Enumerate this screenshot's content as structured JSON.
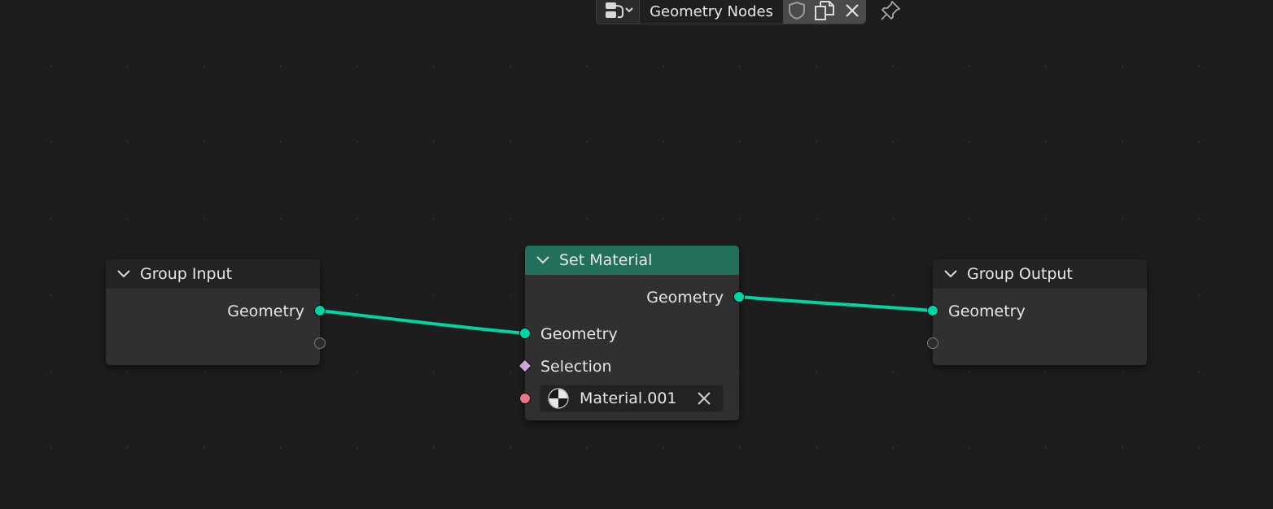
{
  "header": {
    "node_tree_name": "Geometry Nodes",
    "browse_icon": "node-tree-browse-icon",
    "fake_user_icon": "shield-icon",
    "duplicate_icon": "duplicate-icon",
    "unlink_icon": "close-icon",
    "pin_icon": "pin-icon"
  },
  "nodes": {
    "group_input": {
      "title": "Group Input",
      "outputs": [
        {
          "label": "Geometry",
          "type": "geometry"
        }
      ]
    },
    "set_material": {
      "title": "Set Material",
      "outputs": [
        {
          "label": "Geometry",
          "type": "geometry"
        }
      ],
      "inputs": [
        {
          "label": "Geometry",
          "type": "geometry"
        },
        {
          "label": "Selection",
          "type": "boolean-field"
        }
      ],
      "material": {
        "name": "Material.001",
        "icon": "material-sphere-icon",
        "clear_icon": "close-icon"
      }
    },
    "group_output": {
      "title": "Group Output",
      "inputs": [
        {
          "label": "Geometry",
          "type": "geometry"
        }
      ]
    }
  },
  "colors": {
    "background": "#1d1d1d",
    "node_body": "#303030",
    "node_header": "#232323",
    "geometry_header": "#22705c",
    "geometry_socket": "#00d6a3",
    "material_socket": "#eb7582",
    "boolean_field_socket": "#cca6d6",
    "link": "#00d6a3"
  }
}
